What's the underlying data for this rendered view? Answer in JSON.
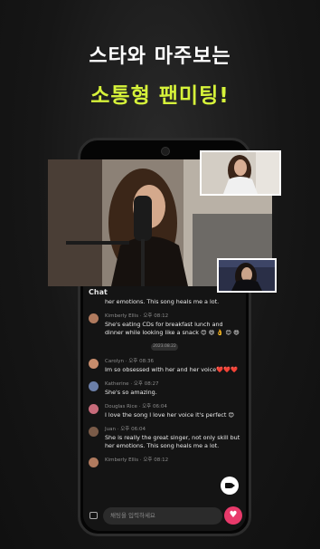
{
  "headline": {
    "line1": "스타와 마주보는",
    "line2": "소통형 팬미팅!",
    "line2_color": "#d6f23a"
  },
  "chat": {
    "title": "Chat",
    "first_message_cont": "her emotions. This song heals me a lot.",
    "date_pill": "2023.08.22",
    "messages": [
      {
        "name": "Kimberly Ellis",
        "time": "오후 08:12",
        "text": "She's eating CDs for breakfast lunch and dinner while looking like a snack 😊 😄 👌 😊 😄"
      },
      {
        "name": "Carolyn",
        "time": "오후 08:36",
        "text": "Im so obsessed with her and her voice❤️❤️❤️"
      },
      {
        "name": "Katherine",
        "time": "오후 08:27",
        "text": "She's so amazing."
      },
      {
        "name": "Douglas Rice",
        "time": "오후 06:04",
        "text": "I love the song I love her voice it's perfect 😊"
      },
      {
        "name": "Juan",
        "time": "오후 06:04",
        "text": "She is really the great singer, not only skill but her emotions. This song heals me a lot."
      },
      {
        "name": "Kimberly Ellis",
        "time": "오후 08:12",
        "text": ""
      }
    ],
    "input_placeholder": "채팅을 입력하세요",
    "heart_icon": "heart-icon",
    "camera_icon": "camera-icon",
    "chat_bubble_icon": "chat-bubble-icon"
  },
  "colors": {
    "accent": "#d6f23a",
    "heart": "#e83a6b",
    "background": "#141414"
  }
}
